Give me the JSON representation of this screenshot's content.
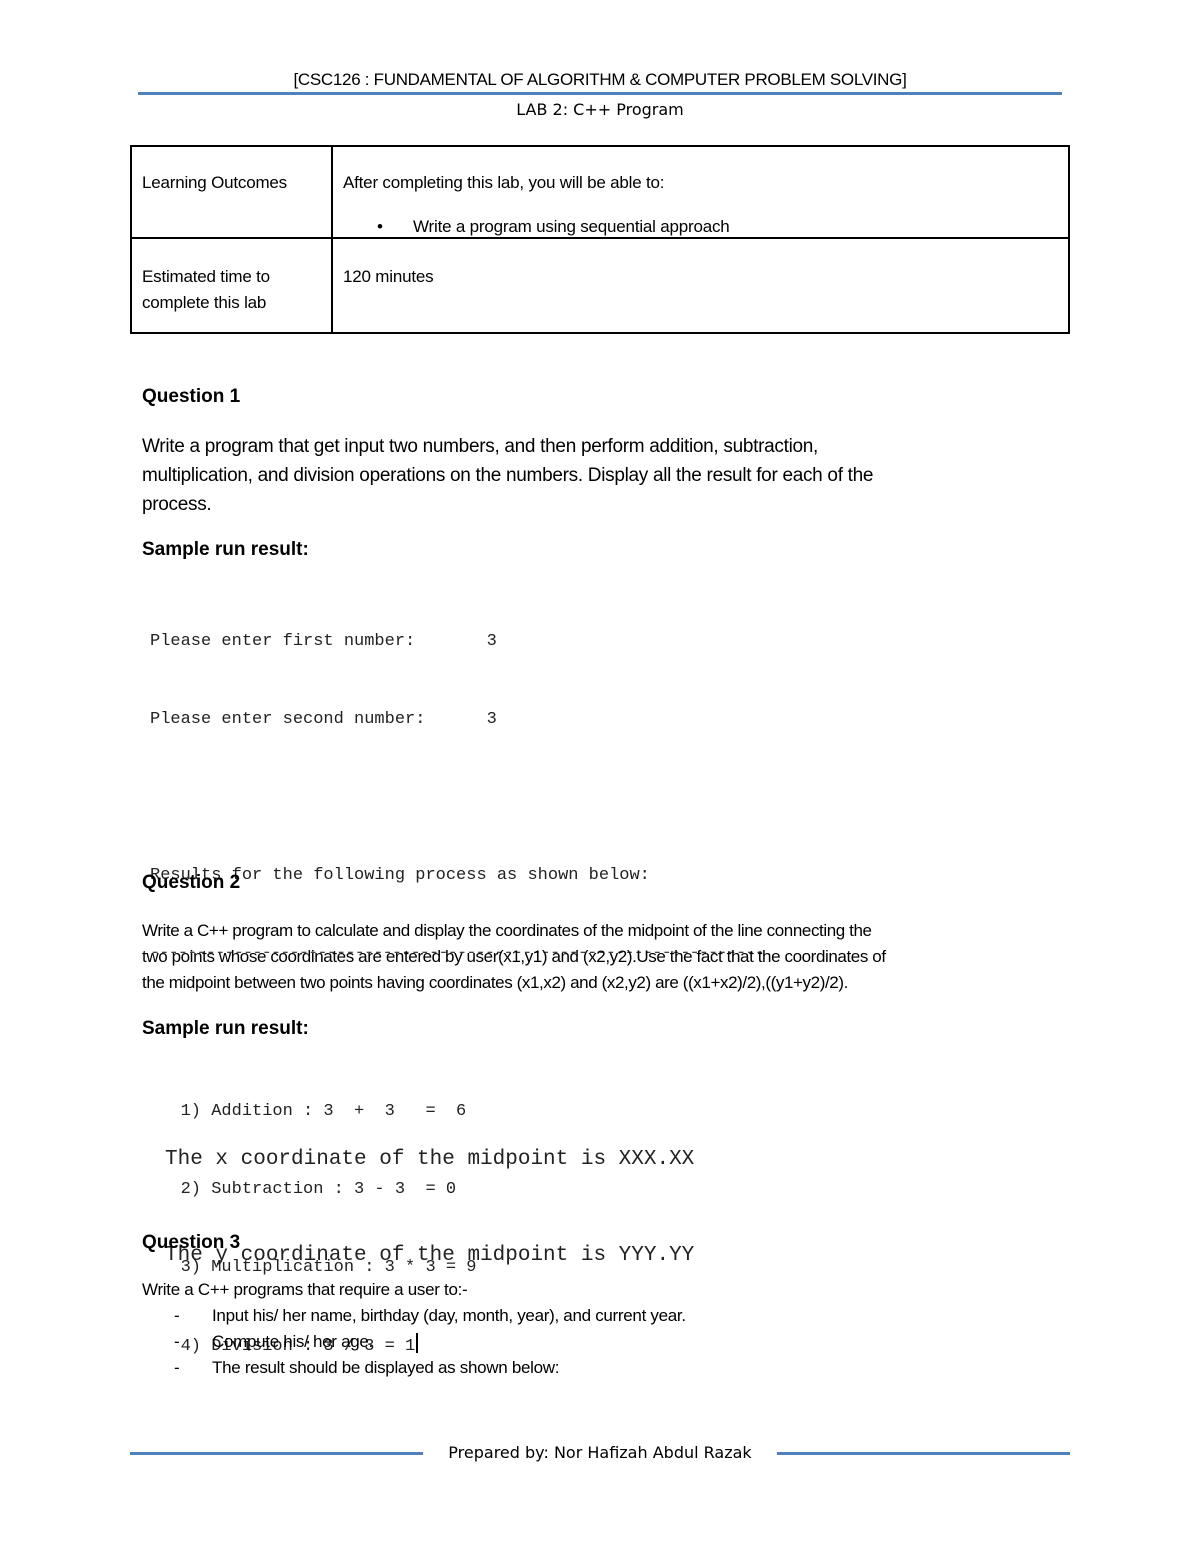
{
  "header": {
    "course_title": "[CSC126 : FUNDAMENTAL OF ALGORITHM & COMPUTER PROBLEM SOLVING]",
    "lab_title": "LAB 2: C++ Program",
    "rule_color": "#4f81bd"
  },
  "info_table": {
    "rows": [
      {
        "label": "Learning Outcomes",
        "value": "After completing this lab, you will be able to:",
        "bullets": [
          "Write a program using sequential approach"
        ]
      },
      {
        "label_lines": [
          "Estimated time to",
          "complete this lab"
        ],
        "value": "120 minutes"
      }
    ]
  },
  "question1": {
    "heading": "Question 1",
    "body_lines": [
      "Write a program that get input two numbers, and then perform   addition, subtraction,",
      "multiplication, and division operations on the numbers. Display all the result for each of the",
      "process."
    ],
    "sample_label": "Sample run result:",
    "console": {
      "prompts": [
        "Please enter first number:       3",
        "Please enter second number:      3"
      ],
      "results_header": "Results for the following process as shown below:",
      "divider": "------------------------------------------------------------------",
      "results": [
        "   1) Addition : 3  +  3   =  6",
        "   2) Subtraction : 3 - 3  = 0",
        "   3) Multiplication : 3 * 3 = 9",
        "   4) Division : 3 / 3 = 1"
      ]
    }
  },
  "question2": {
    "heading": "Question 2",
    "body_lines": [
      "Write a C++ program to calculate and display the coordinates of the midpoint of the line connecting the",
      "two points whose coordinates are entered by user(x1,y1) and (x2,y2).Use the fact that the coordinates of",
      "the midpoint between two points having coordinates (x1,x2) and (x2,y2) are ((x1+x2)/2),((y1+y2)/2)."
    ],
    "sample_label": "Sample run result:",
    "console": [
      "The x coordinate of the midpoint is XXX.XX",
      "The y coordinate of the midpoint is YYY.YY"
    ]
  },
  "question3": {
    "heading": "Question 3",
    "intro": "Write a C++ programs that require a user to:-",
    "list_marker": "-",
    "items": [
      "Input his/ her name, birthday (day, month, year), and current year.",
      "Compute his/ her age.",
      "The result should be displayed as shown below:"
    ]
  },
  "footer": {
    "prepared_by": "Prepared by: Nor Hafizah Abdul Razak"
  }
}
